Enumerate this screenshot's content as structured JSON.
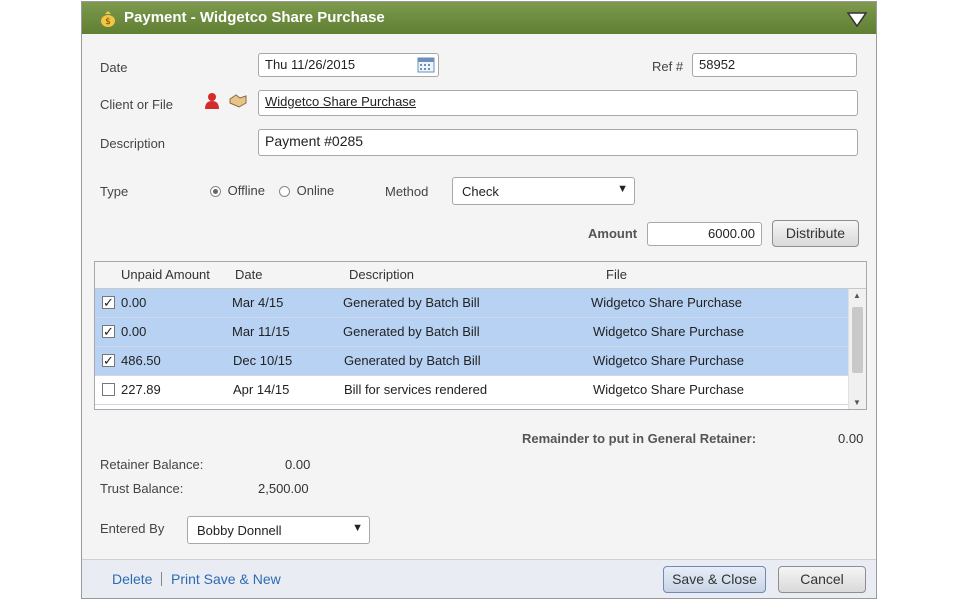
{
  "dialog": {
    "title": "Payment - Widgetco Share Purchase",
    "icons": {
      "logo": "money-bag-icon",
      "collapse": "triangle-down-icon"
    }
  },
  "form": {
    "date_label": "Date",
    "date_value": "Thu 11/26/2015",
    "ref_label": "Ref #",
    "ref_value": "58952",
    "client_label": "Client or File",
    "client_value": "Widgetco Share Purchase",
    "description_label": "Description",
    "description_value": "Payment #0285",
    "type_label": "Type",
    "type_offline": "Offline",
    "type_online": "Online",
    "type_selected": "Offline",
    "method_label": "Method",
    "method_value": "Check",
    "amount_label": "Amount",
    "amount_value": "6000.00",
    "distribute_label": "Distribute"
  },
  "table": {
    "columns": [
      "Unpaid Amount",
      "Date",
      "Description",
      "File"
    ],
    "rows": [
      {
        "checked": true,
        "amount": "0.00",
        "date": "Mar 4/15",
        "description": "Generated by Batch Bill",
        "file": "Widgetco Share Purchase"
      },
      {
        "checked": true,
        "amount": "0.00",
        "date": "Mar 11/15",
        "description": "Generated by Batch Bill",
        "file": "Widgetco Share Purchase"
      },
      {
        "checked": true,
        "amount": "486.50",
        "date": "Dec 10/15",
        "description": "Generated by Batch Bill",
        "file": "Widgetco Share Purchase"
      },
      {
        "checked": false,
        "amount": "227.89",
        "date": "Apr 14/15",
        "description": "Bill for services rendered",
        "file": "Widgetco Share Purchase"
      }
    ]
  },
  "summary": {
    "remainder_label": "Remainder to put in General Retainer:",
    "remainder_value": "0.00",
    "retainer_label": "Retainer Balance:",
    "retainer_value": "0.00",
    "trust_label": "Trust Balance:",
    "trust_value": "2,500.00",
    "entered_by_label": "Entered By",
    "entered_by_value": "Bobby Donnell"
  },
  "footer": {
    "delete_label": "Delete",
    "print_save_new_label": "Print Save & New",
    "save_close_label": "Save & Close",
    "cancel_label": "Cancel"
  },
  "colors": {
    "title_bar": "#6b8a3f",
    "selected_row": "#b7d2f3",
    "link": "#2d6ab3"
  }
}
